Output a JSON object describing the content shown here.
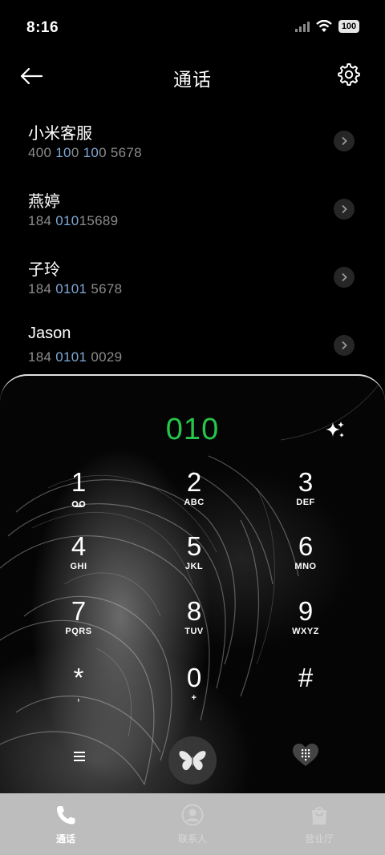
{
  "status": {
    "time": "8:16",
    "battery": "100"
  },
  "header": {
    "title": "通话"
  },
  "contacts": [
    {
      "name": "小米客服",
      "number_parts": [
        "400 ",
        "10",
        "0 ",
        "10",
        "0 5678"
      ]
    },
    {
      "name": "燕婷",
      "number_parts": [
        "184 ",
        "010",
        "15689"
      ]
    },
    {
      "name": "子玲",
      "number_parts": [
        "184 ",
        "0101",
        " 5678"
      ]
    },
    {
      "name": "Jason",
      "number_parts": [
        "184 ",
        "0101",
        " 0029"
      ]
    }
  ],
  "dialpad": {
    "input": "010",
    "keys": [
      {
        "digit": "1",
        "letters": ""
      },
      {
        "digit": "2",
        "letters": "ABC"
      },
      {
        "digit": "3",
        "letters": "DEF"
      },
      {
        "digit": "4",
        "letters": "GHI"
      },
      {
        "digit": "5",
        "letters": "JKL"
      },
      {
        "digit": "6",
        "letters": "MNO"
      },
      {
        "digit": "7",
        "letters": "PQRS"
      },
      {
        "digit": "8",
        "letters": "TUV"
      },
      {
        "digit": "9",
        "letters": "WXYZ"
      },
      {
        "digit": "*",
        "letters": ","
      },
      {
        "digit": "0",
        "letters": "+"
      },
      {
        "digit": "#",
        "letters": ""
      }
    ]
  },
  "tabs": [
    {
      "label": "通话",
      "icon": "phone-icon",
      "active": true
    },
    {
      "label": "联系人",
      "icon": "person-icon",
      "active": false
    },
    {
      "label": "营业厅",
      "icon": "bag-icon",
      "active": false
    }
  ],
  "colors": {
    "accent_green": "#26c64a",
    "highlight_blue": "#7fa8d8",
    "tabbar_bg": "#bdbdbd"
  }
}
